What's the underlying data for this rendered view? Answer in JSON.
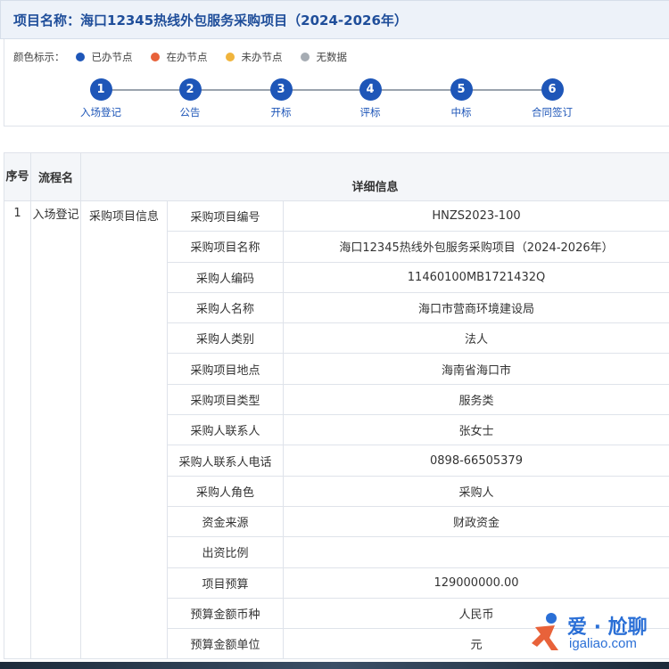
{
  "header": {
    "title": "项目名称：海口12345热线外包服务采购项目（2024-2026年）"
  },
  "legend": {
    "label": "颜色标示：",
    "items": [
      {
        "label": "已办节点",
        "color": "#1e56b8"
      },
      {
        "label": "在办节点",
        "color": "#e8623a"
      },
      {
        "label": "未办节点",
        "color": "#f0b43c"
      },
      {
        "label": "无数据",
        "color": "#a6acb3"
      }
    ]
  },
  "steps": [
    {
      "num": "1",
      "label": "入场登记"
    },
    {
      "num": "2",
      "label": "公告"
    },
    {
      "num": "3",
      "label": "开标"
    },
    {
      "num": "4",
      "label": "评标"
    },
    {
      "num": "5",
      "label": "中标"
    },
    {
      "num": "6",
      "label": "合同签订"
    }
  ],
  "table": {
    "headers": {
      "seq": "序号",
      "name": "流程名",
      "detail": "详细信息"
    },
    "row": {
      "seq": "1",
      "flow": "入场登记",
      "section": "采购项目信息",
      "fields": [
        {
          "label": "采购项目编号",
          "value": "HNZS2023-100"
        },
        {
          "label": "采购项目名称",
          "value": "海口12345热线外包服务采购项目（2024-2026年）"
        },
        {
          "label": "采购人编码",
          "value": "11460100MB1721432Q"
        },
        {
          "label": "采购人名称",
          "value": "海口市营商环境建设局"
        },
        {
          "label": "采购人类别",
          "value": "法人"
        },
        {
          "label": "采购项目地点",
          "value": "海南省海口市"
        },
        {
          "label": "采购项目类型",
          "value": "服务类"
        },
        {
          "label": "采购人联系人",
          "value": "张女士"
        },
        {
          "label": "采购人联系人电话",
          "value": "0898-66505379"
        },
        {
          "label": "采购人角色",
          "value": "采购人"
        },
        {
          "label": "资金来源",
          "value": "财政资金"
        },
        {
          "label": "出资比例",
          "value": ""
        },
        {
          "label": "项目预算",
          "value": "129000000.00"
        },
        {
          "label": "预算金额币种",
          "value": "人民币"
        },
        {
          "label": "预算金额单位",
          "value": "元"
        }
      ]
    }
  },
  "watermark": {
    "text": "爱 · 尬聊",
    "sub": "igaliao.com",
    "color": "#2a6fd6"
  }
}
